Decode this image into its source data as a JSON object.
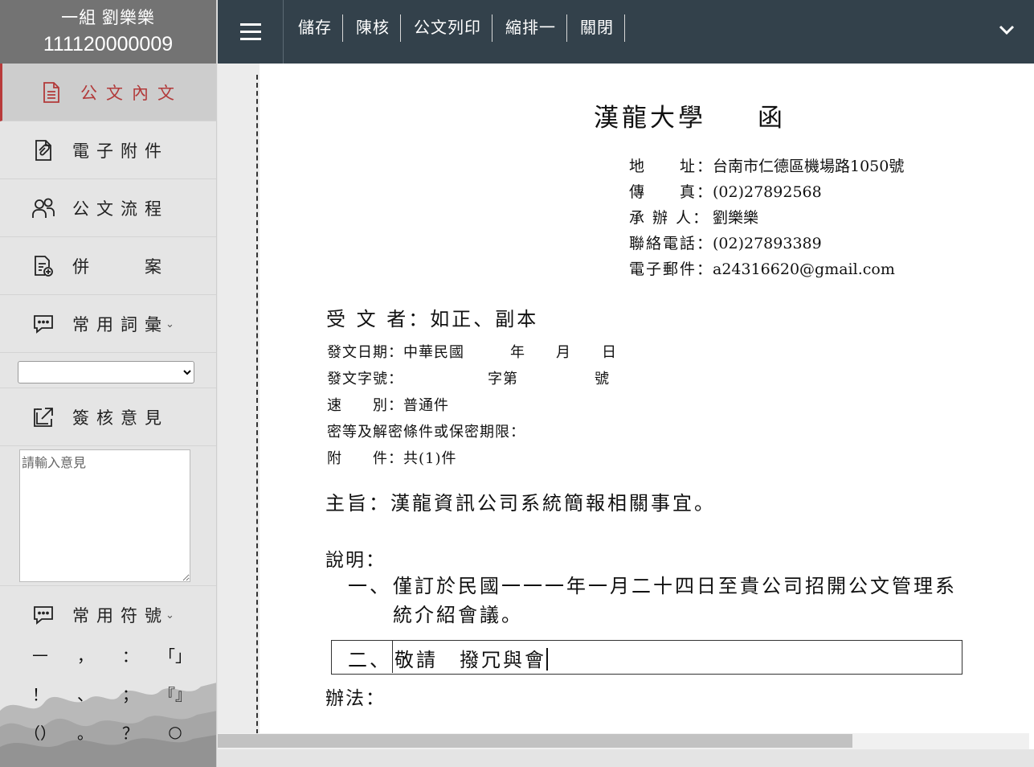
{
  "sidebar": {
    "user_name": "一組 劉樂樂",
    "user_id": "111120000009",
    "items": [
      {
        "label": "公文內文",
        "icon": "document-icon"
      },
      {
        "label": "電子附件",
        "icon": "paperclip-file-icon"
      },
      {
        "label": "公文流程",
        "icon": "people-icon"
      },
      {
        "label": "併　　案",
        "icon": "merge-document-icon"
      },
      {
        "label": "常用詞彙",
        "icon": "chat-bubble-icon"
      },
      {
        "label": "簽核意見",
        "icon": "external-link-icon"
      },
      {
        "label": "常用符號",
        "icon": "chat-bubble-icon"
      }
    ],
    "phrase_select_value": "",
    "opinion_placeholder": "請輸入意見",
    "symbols": [
      "—",
      "，",
      "：",
      "「」",
      "！",
      "、",
      "；",
      "『』",
      "（）",
      "。",
      "？",
      "○"
    ],
    "active_color": "#b23a3a"
  },
  "toolbar": {
    "buttons": [
      "儲存",
      "陳核",
      "公文列印",
      "縮排一",
      "關閉"
    ],
    "bg_color": "#33414b"
  },
  "document": {
    "org": "漢龍大學",
    "doc_type": "函",
    "info": [
      {
        "key": "地　　址：",
        "value": "台南市仁德區機場路1050號"
      },
      {
        "key": "傳　　真：",
        "value": "(02)27892568"
      },
      {
        "key": "承 辦 人：",
        "value": "劉樂樂"
      },
      {
        "key": "聯絡電話：",
        "value": "(02)27893389"
      },
      {
        "key": "電子郵件：",
        "value": "a24316620@gmail.com"
      }
    ],
    "recipient": "受 文 者：如正、副本",
    "meta": [
      "發文日期：中華民國　　　年　　月　　日",
      "發文字號：　　　　　　字第　　　　　號",
      "速　　別：普通件",
      "密等及解密條件或保密期限：",
      "附　　件：共(1)件"
    ],
    "subject": "主旨：漢龍資訊公司系統簡報相關事宜。",
    "explain_label": "說明：",
    "point1_num": "一、",
    "point1_text": "僅訂於民國一一一年一月二十四日至貴公司招開公文管理系統介紹會議。",
    "point2_num": "二、",
    "point2_text": "敬請　撥冗與會",
    "method_label": "辦法："
  }
}
